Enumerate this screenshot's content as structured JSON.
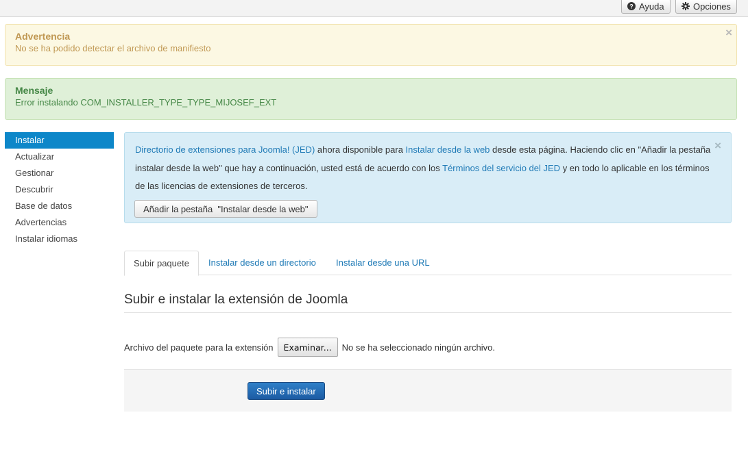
{
  "toolbar": {
    "help_label": "Ayuda",
    "options_label": "Opciones"
  },
  "messages": {
    "warning": {
      "heading": "Advertencia",
      "text": "No se ha podido detectar el archivo de manifiesto",
      "close": "×"
    },
    "message": {
      "heading": "Mensaje",
      "text": "Error instalando COM_INSTALLER_TYPE_TYPE_MIJOSEF_EXT"
    }
  },
  "sidebar": {
    "items": [
      {
        "label": "Instalar",
        "active": true
      },
      {
        "label": "Actualizar"
      },
      {
        "label": "Gestionar"
      },
      {
        "label": "Descubrir"
      },
      {
        "label": "Base de datos"
      },
      {
        "label": "Advertencias"
      },
      {
        "label": "Instalar idiomas"
      }
    ]
  },
  "jed": {
    "link_directory": "Directorio de extensiones para Joomla! (JED)",
    "text_1": " ahora disponible para ",
    "link_install_web": "Instalar desde la web",
    "text_2": " desde esta página.  Haciendo clic en \"Añadir la pestaña instalar desde la web\" que hay a continuación, usted está de acuerdo con los ",
    "link_terms": "Términos del servicio del JED",
    "text_3": " y en todo lo aplicable en los términos de las licencias de extensiones de terceros.",
    "button_label": "Añadir la pestaña  \"Instalar desde la web\"",
    "close": "×"
  },
  "tabs": [
    {
      "label": "Subir paquete",
      "active": true
    },
    {
      "label": "Instalar desde un directorio"
    },
    {
      "label": "Instalar desde una URL"
    }
  ],
  "upload": {
    "title": "Subir e instalar la extensión de Joomla",
    "file_label": "Archivo del paquete para la extensión",
    "browse_label": "Examinar...",
    "no_file_text": "No se ha seleccionado ningún archivo.",
    "submit_label": "Subir e instalar"
  },
  "colors": {
    "sidebar_active": "#0d87c9",
    "link": "#1f7ab6",
    "primary_button": "#1c5ba3"
  }
}
